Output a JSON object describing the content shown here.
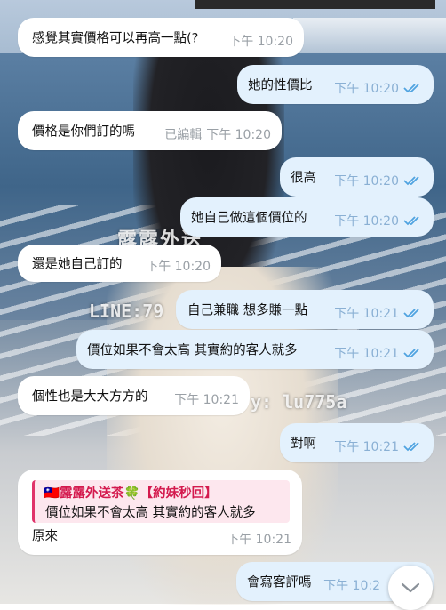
{
  "messages": [
    {
      "id": "m1",
      "side": "in",
      "text": "感覺其實價格可以再高一點(?",
      "time": "下午 10:20"
    },
    {
      "id": "m2",
      "side": "out",
      "text": "她的性價比",
      "time": "下午 10:20",
      "read": true
    },
    {
      "id": "m3",
      "side": "in",
      "text": "價格是你們訂的嗎",
      "edited": "已編輯",
      "time": "下午 10:20"
    },
    {
      "id": "m4",
      "side": "out",
      "text": "很高",
      "time": "下午 10:20",
      "read": true
    },
    {
      "id": "m5",
      "side": "out",
      "text": "她自己做這個價位的",
      "time": "下午 10:20",
      "read": true
    },
    {
      "id": "m6",
      "side": "in",
      "text": "還是她自己訂的",
      "time": "下午 10:20"
    },
    {
      "id": "m7",
      "side": "out",
      "text": "自己兼職 想多賺一點",
      "time": "下午 10:21",
      "read": true
    },
    {
      "id": "m8",
      "side": "out",
      "text": "價位如果不會太高 其實約的客人就多",
      "time": "下午 10:21",
      "read": true
    },
    {
      "id": "m9",
      "side": "in",
      "text": "個性也是大大方方的",
      "time": "下午 10:21"
    },
    {
      "id": "m10",
      "side": "out",
      "text": "對啊",
      "time": "下午 10:21",
      "read": true
    },
    {
      "id": "m11",
      "side": "in",
      "reply": {
        "sender": "🇹🇼露露外送茶🍀【約妹秒回】",
        "text": "價位如果不會太高 其實約的客人就多"
      },
      "text": "原來",
      "time": "下午 10:21"
    },
    {
      "id": "m12",
      "side": "out",
      "text": "會寫客評嗎",
      "time": "下午 10:2",
      "read": true
    }
  ],
  "wallpaper": {
    "watermarks": [
      "露露外送",
      "LINE:79",
      "y: lu775a"
    ]
  },
  "colors": {
    "incoming_bubble": "#ffffff",
    "outgoing_bubble": "#e3f1fd",
    "read_check": "#4fa3e0",
    "reply_accent": "#e0336a"
  },
  "icons": {
    "read": "double-check-icon",
    "scroll": "chevron-down-icon"
  }
}
